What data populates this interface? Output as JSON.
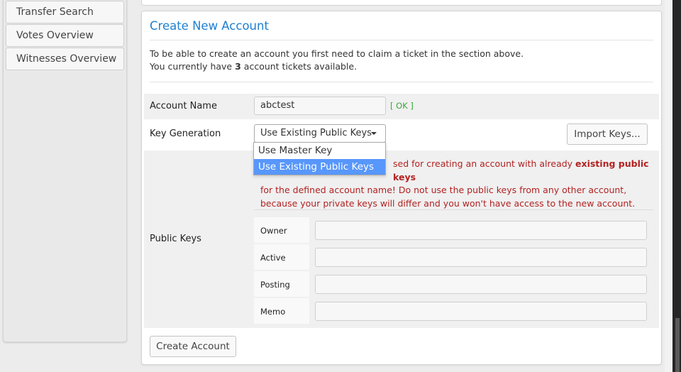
{
  "sidebar": {
    "items": [
      {
        "label": "Transfer Search"
      },
      {
        "label": "Votes Overview"
      },
      {
        "label": "Witnesses Overview"
      }
    ]
  },
  "panel": {
    "title": "Create New Account",
    "intro_line1": "To be able to create an account you first need to claim a ticket in the section above.",
    "intro_line2_prefix": "You currently have ",
    "intro_ticket_count": "3",
    "intro_line2_suffix": " account tickets available."
  },
  "form": {
    "account_name_label": "Account Name",
    "account_name_value": "abctest",
    "account_name_status": "[ OK ]",
    "key_generation_label": "Key Generation",
    "key_generation_selected": "Use Existing Public Keys",
    "key_generation_options": [
      "Use Master Key",
      "Use Existing Public Keys"
    ],
    "import_keys_button": "Import Keys...",
    "public_keys_label": "Public Keys",
    "warning_part1": "sed for creating an account with already ",
    "warning_bold": "existing public keys",
    "warning_line2": "for the defined account name! Do not use the public keys from any other account,",
    "warning_line3": "because your private keys will differ and you won't have access to the new account.",
    "key_fields": [
      {
        "label": "Owner",
        "value": ""
      },
      {
        "label": "Active",
        "value": ""
      },
      {
        "label": "Posting",
        "value": ""
      },
      {
        "label": "Memo",
        "value": ""
      }
    ],
    "create_button": "Create Account"
  }
}
